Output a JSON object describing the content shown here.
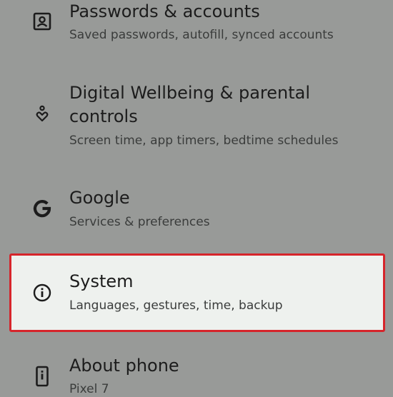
{
  "settings": {
    "items": [
      {
        "id": "passwords",
        "title": "Passwords & accounts",
        "subtitle": "Saved passwords, autofill, synced accounts",
        "icon": "account-box-icon"
      },
      {
        "id": "wellbeing",
        "title": "Digital Wellbeing & parental controls",
        "title_line1": "Digital Wellbeing & parental",
        "title_line2": "controls",
        "subtitle": "Screen time, app timers, bedtime schedules",
        "icon": "wellbeing-icon"
      },
      {
        "id": "google",
        "title": "Google",
        "subtitle": "Services & preferences",
        "icon": "google-icon"
      },
      {
        "id": "system",
        "title": "System",
        "subtitle": "Languages, gestures, time, backup",
        "icon": "info-icon",
        "highlighted": true
      },
      {
        "id": "about",
        "title": "About phone",
        "subtitle": "Pixel 7",
        "icon": "phone-icon"
      }
    ]
  },
  "colors": {
    "background": "#989a98",
    "highlight_background": "#eef1ee",
    "highlight_border": "#d6252b",
    "text_primary": "#1c1c1c",
    "text_secondary": "#3a3c3b"
  }
}
